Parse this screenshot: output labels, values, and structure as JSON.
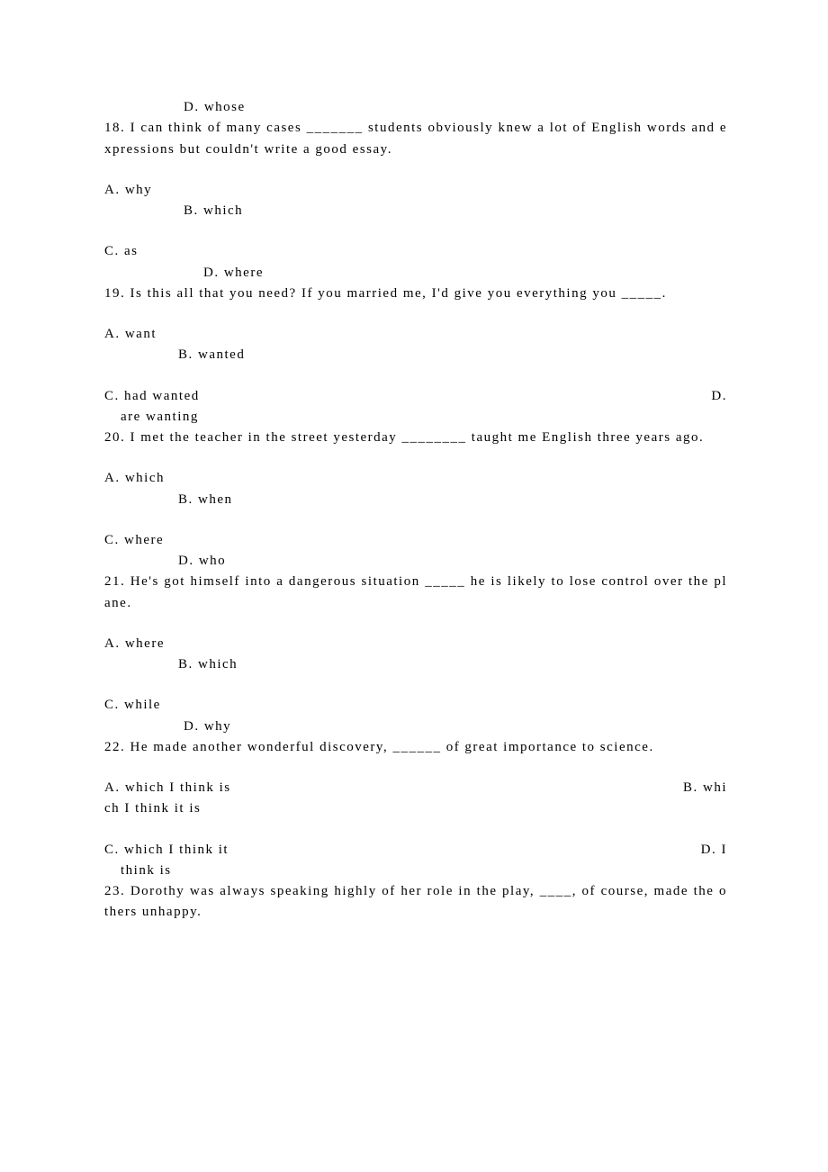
{
  "lines": {
    "l17d": "D.  whose",
    "q18": "18.  I  can  think  of  many  cases  _______  students  obviously  knew  a  lot  of  English  words  and  expressions  but  couldn't  write  a  good  essay.",
    "l18a": "A.  why",
    "l18b": "B.  which",
    "l18c": "C.  as",
    "l18d": "D.  where",
    "q19": "19.  Is  this  all  that  you  need?  If  you  married  me,  I'd  give  you  everything  you  _____.",
    "l19a": "A.  want",
    "l19b": "B.  wanted",
    "l19c_left": "C.  had  wanted",
    "l19d_right": "D.",
    "l19d_cont": "  are  wanting",
    "q20": "20.  I  met  the  teacher  in  the  street  yesterday  ________  taught  me  English  three  years  ago.",
    "l20a": "A.  which",
    "l20b": "B.  when",
    "l20c": "C.  where",
    "l20d": "D.  who",
    "q21": "21.  He's  got  himself  into  a  dangerous  situation  _____  he  is  likely  to  lose  control  over  the  plane.",
    "l21a": "A.  where",
    "l21b": "B.  which",
    "l21c": "C.  while",
    "l21d": "D.  why",
    "q22": "22.  He  made  another  wonderful  discovery,  ______  of  great  importance  to  science.",
    "l22a_left": "A.  which  I  think  is",
    "l22b_right": "B.  whi",
    "l22b_cont": "ch  I  think  it  is",
    "l22c_left": "C.  which  I  think  it",
    "l22d_right": "D.  I",
    "l22d_cont": "  think  is",
    "q23": "23.  Dorothy  was  always  speaking  highly  of  her  role  in  the  play,  ____,  of  course,  made  the  others  unhappy."
  }
}
